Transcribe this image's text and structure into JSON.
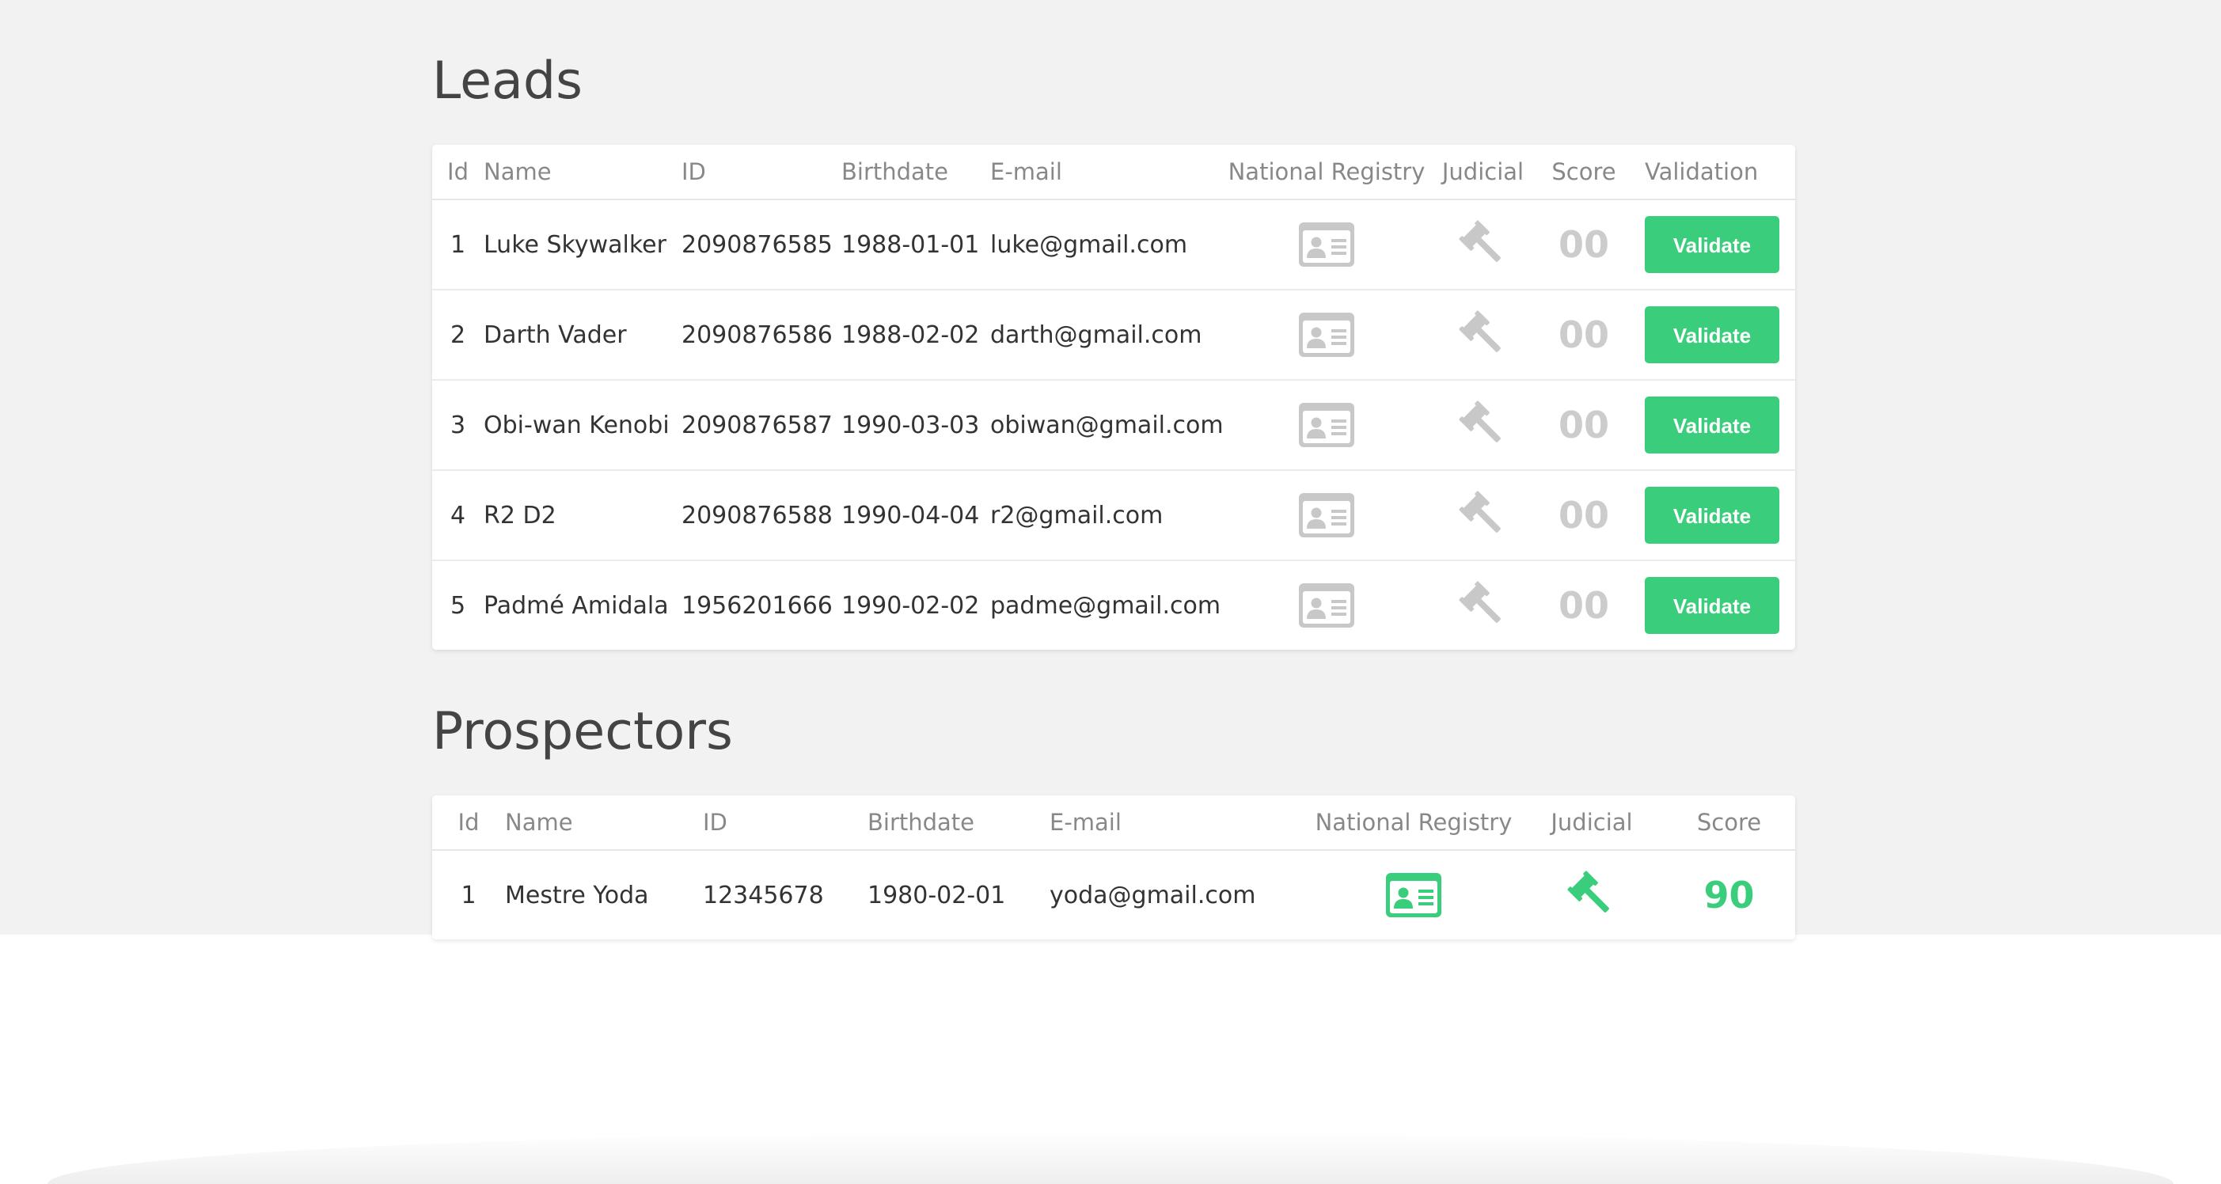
{
  "colors": {
    "accent": "#3acd7b",
    "inactive_icon": "#c8c8c8",
    "page_background": "#f2f2f2"
  },
  "leads": {
    "title": "Leads",
    "columns": {
      "id": "Id",
      "name": "Name",
      "doc": "ID",
      "birthdate": "Birthdate",
      "email": "E-mail",
      "registry": "National Registry",
      "judicial": "Judicial",
      "score": "Score",
      "validation": "Validation"
    },
    "rows": [
      {
        "id": "1",
        "name": "Luke Skywalker",
        "doc": "2090876585",
        "birthdate": "1988-01-01",
        "email": "luke@gmail.com",
        "registry_icon": "id-card-icon",
        "judicial_icon": "gavel-icon",
        "score": "00",
        "button": "Validate"
      },
      {
        "id": "2",
        "name": "Darth Vader",
        "doc": "2090876586",
        "birthdate": "1988-02-02",
        "email": "darth@gmail.com",
        "registry_icon": "id-card-icon",
        "judicial_icon": "gavel-icon",
        "score": "00",
        "button": "Validate"
      },
      {
        "id": "3",
        "name": "Obi-wan Kenobi",
        "doc": "2090876587",
        "birthdate": "1990-03-03",
        "email": "obiwan@gmail.com",
        "registry_icon": "id-card-icon",
        "judicial_icon": "gavel-icon",
        "score": "00",
        "button": "Validate"
      },
      {
        "id": "4",
        "name": "R2 D2",
        "doc": "2090876588",
        "birthdate": "1990-04-04",
        "email": "r2@gmail.com",
        "registry_icon": "id-card-icon",
        "judicial_icon": "gavel-icon",
        "score": "00",
        "button": "Validate"
      },
      {
        "id": "5",
        "name": "Padmé Amidala",
        "doc": "1956201666",
        "birthdate": "1990-02-02",
        "email": "padme@gmail.com",
        "registry_icon": "id-card-icon",
        "judicial_icon": "gavel-icon",
        "score": "00",
        "button": "Validate"
      }
    ]
  },
  "prospectors": {
    "title": "Prospectors",
    "columns": {
      "id": "Id",
      "name": "Name",
      "doc": "ID",
      "birthdate": "Birthdate",
      "email": "E-mail",
      "registry": "National Registry",
      "judicial": "Judicial",
      "score": "Score"
    },
    "rows": [
      {
        "id": "1",
        "name": "Mestre Yoda",
        "doc": "12345678",
        "birthdate": "1980-02-01",
        "email": "yoda@gmail.com",
        "registry_icon": "id-card-icon",
        "judicial_icon": "gavel-icon",
        "score": "90"
      }
    ]
  }
}
